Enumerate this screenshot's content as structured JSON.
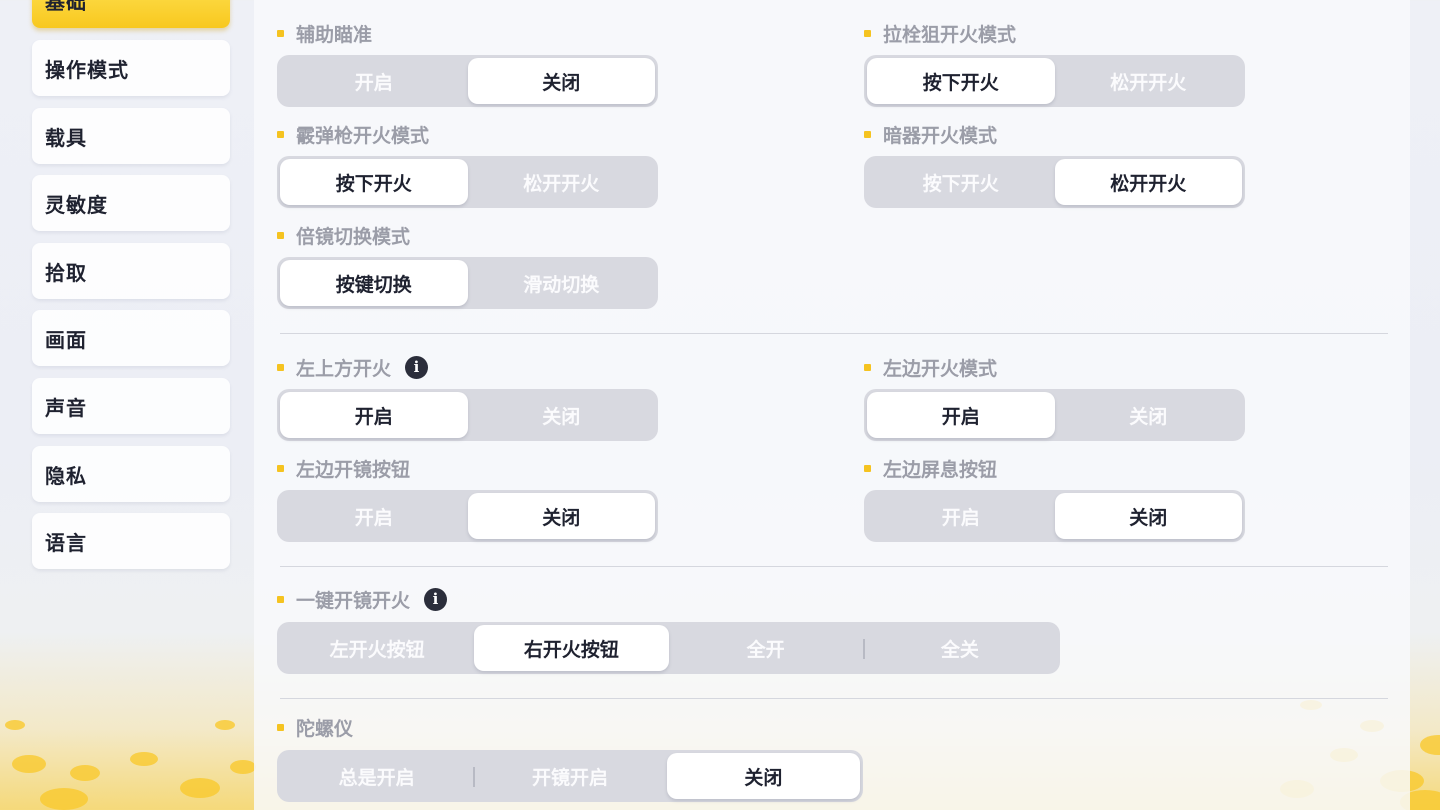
{
  "sidebar": {
    "items": [
      {
        "label": "基础"
      },
      {
        "label": "操作模式"
      },
      {
        "label": "载具"
      },
      {
        "label": "灵敏度"
      },
      {
        "label": "拾取"
      },
      {
        "label": "画面"
      },
      {
        "label": "声音"
      },
      {
        "label": "隐私"
      },
      {
        "label": "语言"
      }
    ],
    "active_index": 0
  },
  "settings": {
    "aim_assist": {
      "label": "辅助瞄准",
      "options": [
        "开启",
        "关闭"
      ],
      "selected": "关闭"
    },
    "bolt_sniper_fire": {
      "label": "拉栓狙开火模式",
      "options": [
        "按下开火",
        "松开开火"
      ],
      "selected": "按下开火"
    },
    "shotgun_fire": {
      "label": "霰弹枪开火模式",
      "options": [
        "按下开火",
        "松开开火"
      ],
      "selected": "按下开火"
    },
    "hidden_weapon_fire": {
      "label": "暗器开火模式",
      "options": [
        "按下开火",
        "松开开火"
      ],
      "selected": "松开开火"
    },
    "scope_switch": {
      "label": "倍镜切换模式",
      "options": [
        "按键切换",
        "滑动切换"
      ],
      "selected": "按键切换"
    },
    "top_left_fire": {
      "label": "左上方开火",
      "options": [
        "开启",
        "关闭"
      ],
      "selected": "开启"
    },
    "left_fire_mode": {
      "label": "左边开火模式",
      "options": [
        "开启",
        "关闭"
      ],
      "selected": "开启"
    },
    "left_scope_button": {
      "label": "左边开镜按钮",
      "options": [
        "开启",
        "关闭"
      ],
      "selected": "关闭"
    },
    "left_breath_button": {
      "label": "左边屏息按钮",
      "options": [
        "开启",
        "关闭"
      ],
      "selected": "关闭"
    },
    "one_tap_scope_fire": {
      "label": "一键开镜开火",
      "options": [
        "左开火按钮",
        "右开火按钮",
        "全开",
        "全关"
      ],
      "selected": "右开火按钮"
    },
    "gyroscope": {
      "label": "陀螺仪",
      "options": [
        "总是开启",
        "开镜开启",
        "关闭"
      ],
      "selected": "关闭"
    }
  },
  "colors": {
    "accent_yellow": "#f8c81e",
    "selected_bg": "#ffffff",
    "segment_bg": "#d8d9e0",
    "label_gray": "#9b9da8",
    "text_dark": "#1f2230"
  },
  "icons": {
    "info": "info-icon",
    "bullet": "square-bullet"
  }
}
